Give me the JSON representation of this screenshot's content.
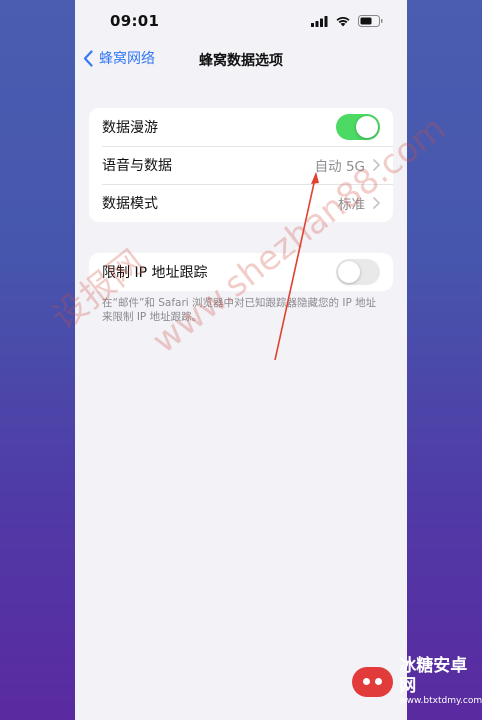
{
  "status": {
    "time": "09:01"
  },
  "nav": {
    "back_label": "蜂窝网络",
    "title": "蜂窝数据选项"
  },
  "group1": {
    "rows": [
      {
        "label": "数据漫游",
        "toggle": "on"
      },
      {
        "label": "语音与数据",
        "value": "自动 5G"
      },
      {
        "label": "数据模式",
        "value": "标准"
      }
    ]
  },
  "group2": {
    "rows": [
      {
        "label": "限制 IP 地址跟踪",
        "toggle": "off"
      }
    ],
    "footnote": "在“邮件”和 Safari 浏览器中对已知跟踪器隐藏您的 IP 地址来限制 IP 地址跟踪。"
  },
  "watermark": {
    "line1": "设报网",
    "line2": "www.shezhan88.com"
  },
  "logo": {
    "title": "冰糖安卓网",
    "url": "www.btxtdmy.com"
  },
  "colors": {
    "accent": "#3478f6",
    "toggle_on": "#4cd964",
    "annotation_arrow": "#e0402c"
  }
}
